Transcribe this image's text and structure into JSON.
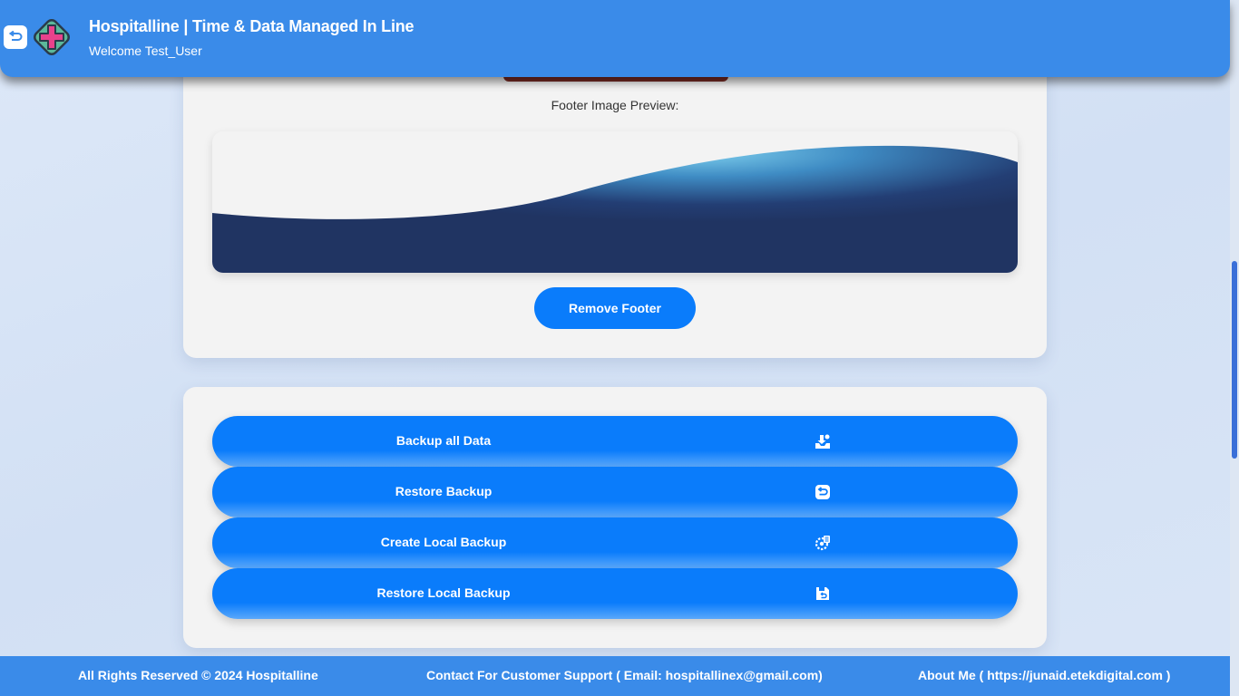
{
  "header": {
    "title": "Hospitalline | Time & Data Managed In Line",
    "welcome": "Welcome Test_User",
    "back_icon": "back-arrow-icon",
    "logo_icon": "medical-cross-logo"
  },
  "footer_card": {
    "preview_label": "Footer Image Preview:",
    "remove_label": "Remove Footer"
  },
  "backup_card": {
    "buttons": [
      {
        "label": "Backup all Data",
        "icon": "download-tray-icon"
      },
      {
        "label": "Restore Backup",
        "icon": "restore-arrow-icon"
      },
      {
        "label": "Create Local Backup",
        "icon": "gear-chip-icon"
      },
      {
        "label": "Restore Local Backup",
        "icon": "floppy-disk-icon"
      }
    ]
  },
  "footer": {
    "copyright": "All Rights Reserved © 2024 Hospitalline",
    "support": "Contact For Customer Support ( Email: hospitallinex@gmail.com)",
    "about": "About Me ( https://junaid.etekdigital.com )"
  },
  "colors": {
    "header_bg": "#3a8be9",
    "button_blue": "#0a7cfb",
    "card_bg": "#f3f3f3"
  }
}
